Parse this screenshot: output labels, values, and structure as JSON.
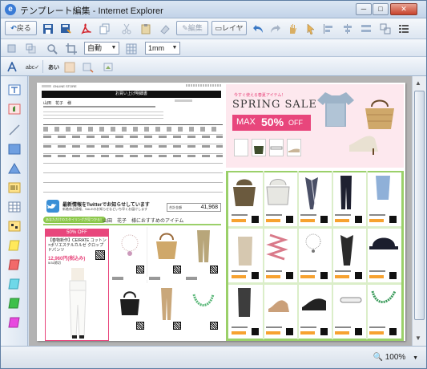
{
  "window": {
    "title": "テンプレート編集 - Internet Explorer",
    "minimize": "─",
    "maximize": "□",
    "close": "✕"
  },
  "toolbar1": {
    "back_label": "戻る",
    "edit_label": "編集",
    "layer_label": "レイヤー"
  },
  "toolbar2": {
    "auto_select": "自動"
  },
  "toolbar3": {
    "unit_select": "1mm"
  },
  "status": {
    "zoom": "100%"
  },
  "receipt": {
    "store_name": "ONLINE STORE",
    "header_title": "お買い上げ明細書",
    "customer": "山田　花子　様",
    "total_label": "合計金額",
    "total_value": "41,968",
    "twitter_line1": "最新情報をTwitterでお知らせしています",
    "twitter_line2": "新着商品情報、SALEのお知らせなどいち早くお届けします",
    "recommend_badge": "あなただけのスタイリングが見つかる！",
    "recommend_title": "山田　花子　様におすすめのアイテム"
  },
  "feature": {
    "discount_label": "50% OFF",
    "product_name": "【春物新作】CEIRATE コットン×ポリエステルカルゼ クロップドパンツ",
    "price": "12,960円(税込み)",
    "date": "5/31締切"
  },
  "sale": {
    "caption": "今すぐ使える春夏アイテム！",
    "title": "SPRING SALE",
    "max_label": "MAX",
    "discount": "50%",
    "off": "OFF"
  },
  "colors": {
    "banner_pink": "#e8467c",
    "sale_bg": "#fde8ee",
    "green_border": "#9bd06a",
    "twitter_blue": "#3a8fd6",
    "orange_tag": "#f7a230"
  }
}
